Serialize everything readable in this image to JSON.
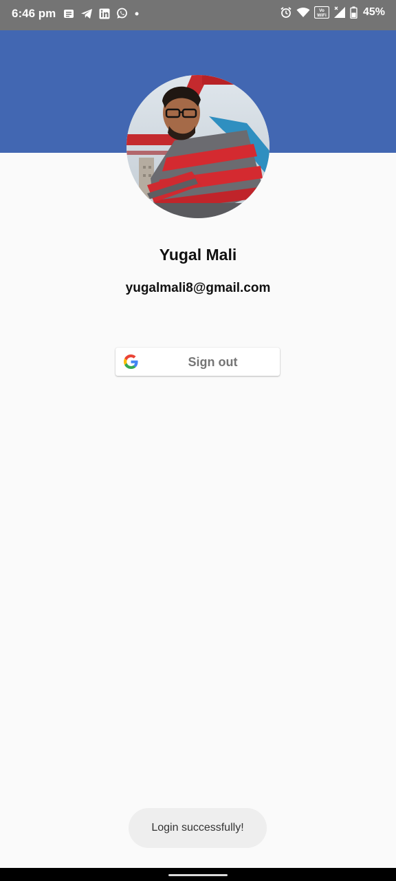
{
  "status_bar": {
    "time": "6:46 pm",
    "battery": "45%",
    "left_icons": [
      "message-icon",
      "telegram-icon",
      "linkedin-icon",
      "whatsapp-icon",
      "notification-dot-icon"
    ],
    "right_icons": [
      "alarm-icon",
      "wifi-icon",
      "volte-icon",
      "signal-icon",
      "battery-icon"
    ],
    "volte_text": "Vo WiFi"
  },
  "profile": {
    "name": "Yugal Mali",
    "email": "yugalmali8@gmail.com"
  },
  "signout_button": {
    "label": "Sign out",
    "icon": "google-g-icon"
  },
  "toast": {
    "message": "Login successfully!"
  },
  "colors": {
    "header": "#4267b2",
    "status_bar": "#747474",
    "background": "#fafafa"
  }
}
